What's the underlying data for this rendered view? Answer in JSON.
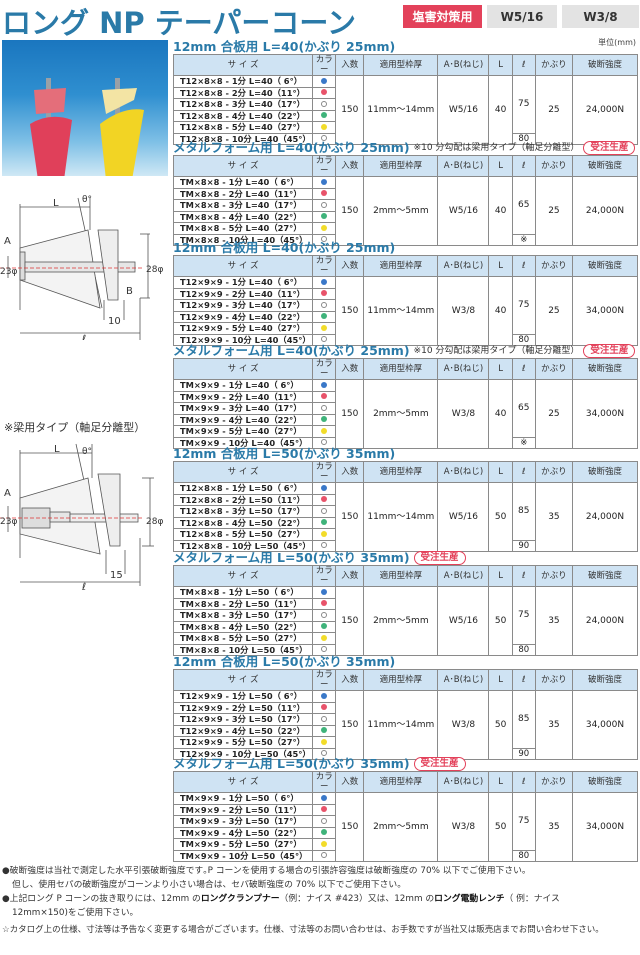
{
  "header": {
    "title": "ロング NP テーパーコーン",
    "tags": [
      "塩害対策用",
      "W5/16",
      "W3/8"
    ],
    "unit": "単位(mm)"
  },
  "photo": {
    "description": "red and yellow taper cones photo"
  },
  "diagrams": {
    "standard": {
      "labels": {
        "L": "L",
        "theta": "θ°",
        "A": "A",
        "B": "B",
        "phi23": "23φ",
        "phi28": "28φ",
        "dim10": "10",
        "ell": "ℓ"
      }
    },
    "beam_label": "※梁用タイプ（軸足分離型）",
    "beam": {
      "labels": {
        "L": "L",
        "theta": "θ°",
        "A": "A",
        "phi23": "23φ",
        "phi28": "28φ",
        "dim15": "15",
        "ell": "ℓ"
      }
    }
  },
  "columns": [
    "サ イ ズ",
    "カラー",
    "入数",
    "適用型枠厚",
    "A･B(ねじ)",
    "L",
    "ℓ",
    "かぶり",
    "破断強度"
  ],
  "colors": {
    "blue": "#3a78c8",
    "red": "#e8536a",
    "white": "#ffffff",
    "green": "#3fb37a",
    "yellow": "#f2dc2a"
  },
  "sections": [
    {
      "title": "12mm 合板用  L=40(かぶり 25mm)",
      "note": "",
      "badge": "",
      "rows": [
        {
          "size": "T12×8×8 - 1分   L=40（ 6°）",
          "color": "blue"
        },
        {
          "size": "T12×8×8 - 2分   L=40（11°）",
          "color": "red"
        },
        {
          "size": "T12×8×8 - 3分   L=40（17°）",
          "color": "white"
        },
        {
          "size": "T12×8×8 - 4分   L=40（22°）",
          "color": "green"
        },
        {
          "size": "T12×8×8 - 5分   L=40（27°）",
          "color": "yellow"
        },
        {
          "size": "T12×8×8 - 10分 L=40（45°）",
          "color": "white"
        }
      ],
      "qty": "150",
      "thickness": "11mm～14mm",
      "thread": "W5/16",
      "L": "40",
      "ell": "75",
      "ell_last": "80",
      "cover": "25",
      "strength": "24,000N"
    },
    {
      "title": "メタルフォーム用  L=40(かぶり 25mm)",
      "note": "※10 分勾配は梁用タイプ（軸足分離型）",
      "badge": "受注生産",
      "rows": [
        {
          "size": "TM×8×8 - 1分     L=40（ 6°）",
          "color": "blue"
        },
        {
          "size": "TM×8×8 - 2分     L=40（11°）",
          "color": "red"
        },
        {
          "size": "TM×8×8 - 3分     L=40（17°）",
          "color": "white"
        },
        {
          "size": "TM×8×8 - 4分     L=40（22°）",
          "color": "green"
        },
        {
          "size": "TM×8×8 - 5分     L=40（27°）",
          "color": "yellow"
        },
        {
          "size": "TM×8×8 - 10分  L=40（45°）",
          "color": "white"
        }
      ],
      "qty": "150",
      "thickness": "2mm～5mm",
      "thread": "W5/16",
      "L": "40",
      "ell": "65",
      "ell_last": "※",
      "cover": "25",
      "strength": "24,000N"
    },
    {
      "title": "12mm 合板用  L=40(かぶり 25mm)",
      "note": "",
      "badge": "",
      "rows": [
        {
          "size": "T12×9×9 - 1分   L=40（ 6°）",
          "color": "blue"
        },
        {
          "size": "T12×9×9 - 2分   L=40（11°）",
          "color": "red"
        },
        {
          "size": "T12×9×9 - 3分   L=40（17°）",
          "color": "white"
        },
        {
          "size": "T12×9×9 - 4分   L=40（22°）",
          "color": "green"
        },
        {
          "size": "T12×9×9 - 5分   L=40（27°）",
          "color": "yellow"
        },
        {
          "size": "T12×9×9 - 10分 L=40（45°）",
          "color": "white"
        }
      ],
      "qty": "150",
      "thickness": "11mm～14mm",
      "thread": "W3/8",
      "L": "40",
      "ell": "75",
      "ell_last": "80",
      "cover": "25",
      "strength": "34,000N"
    },
    {
      "title": "メタルフォーム用  L=40(かぶり 25mm)",
      "note": "※10 分勾配は梁用タイプ（軸足分離型）",
      "badge": "受注生産",
      "rows": [
        {
          "size": "TM×9×9 - 1分   L=40（ 6°）",
          "color": "blue"
        },
        {
          "size": "TM×9×9 - 2分   L=40（11°）",
          "color": "red"
        },
        {
          "size": "TM×9×9 - 3分   L=40（17°）",
          "color": "white"
        },
        {
          "size": "TM×9×9 - 4分   L=40（22°）",
          "color": "green"
        },
        {
          "size": "TM×9×9 - 5分   L=40（27°）",
          "color": "yellow"
        },
        {
          "size": "TM×9×9 - 10分 L=40（45°）",
          "color": "white"
        }
      ],
      "qty": "150",
      "thickness": "2mm～5mm",
      "thread": "W3/8",
      "L": "40",
      "ell": "65",
      "ell_last": "※",
      "cover": "25",
      "strength": "34,000N"
    },
    {
      "title": "12mm 合板用  L=50(かぶり 35mm)",
      "note": "",
      "badge": "",
      "rows": [
        {
          "size": "T12×8×8 - 1分   L=50（ 6°）",
          "color": "blue"
        },
        {
          "size": "T12×8×8 - 2分   L=50（11°）",
          "color": "red"
        },
        {
          "size": "T12×8×8 - 3分   L=50（17°）",
          "color": "white"
        },
        {
          "size": "T12×8×8 - 4分   L=50（22°）",
          "color": "green"
        },
        {
          "size": "T12×8×8 - 5分   L=50（27°）",
          "color": "yellow"
        },
        {
          "size": "T12×8×8 - 10分 L=50（45°）",
          "color": "white"
        }
      ],
      "qty": "150",
      "thickness": "11mm～14mm",
      "thread": "W5/16",
      "L": "50",
      "ell": "85",
      "ell_last": "90",
      "cover": "35",
      "strength": "24,000N"
    },
    {
      "title": "メタルフォーム用  L=50(かぶり 35mm)",
      "note": "",
      "badge": "受注生産",
      "rows": [
        {
          "size": "TM×8×8 - 1分     L=50（ 6°）",
          "color": "blue"
        },
        {
          "size": "TM×8×8 - 2分     L=50（11°）",
          "color": "red"
        },
        {
          "size": "TM×8×8 - 3分     L=50（17°）",
          "color": "white"
        },
        {
          "size": "TM×8×8 - 4分     L=50（22°）",
          "color": "green"
        },
        {
          "size": "TM×8×8 - 5分     L=50（27°）",
          "color": "yellow"
        },
        {
          "size": "TM×8×8 - 10分  L=50（45°）",
          "color": "white"
        }
      ],
      "qty": "150",
      "thickness": "2mm～5mm",
      "thread": "W5/16",
      "L": "50",
      "ell": "75",
      "ell_last": "80",
      "cover": "35",
      "strength": "24,000N"
    },
    {
      "title": "12mm 合板用  L=50(かぶり 35mm)",
      "note": "",
      "badge": "",
      "rows": [
        {
          "size": "T12×9×9 - 1分   L=50（ 6°）",
          "color": "blue"
        },
        {
          "size": "T12×9×9 - 2分   L=50（11°）",
          "color": "red"
        },
        {
          "size": "T12×9×9 - 3分   L=50（17°）",
          "color": "white"
        },
        {
          "size": "T12×9×9 - 4分   L=50（22°）",
          "color": "green"
        },
        {
          "size": "T12×9×9 - 5分   L=50（27°）",
          "color": "yellow"
        },
        {
          "size": "T12×9×9 - 10分 L=50（45°）",
          "color": "white"
        }
      ],
      "qty": "150",
      "thickness": "11mm～14mm",
      "thread": "W3/8",
      "L": "50",
      "ell": "85",
      "ell_last": "90",
      "cover": "35",
      "strength": "34,000N"
    },
    {
      "title": "メタルフォーム用  L=50(かぶり 35mm)",
      "note": "",
      "badge": "受注生産",
      "rows": [
        {
          "size": "TM×9×9 - 1分     L=50（ 6°）",
          "color": "blue"
        },
        {
          "size": "TM×9×9 - 2分     L=50（11°）",
          "color": "red"
        },
        {
          "size": "TM×9×9 - 3分     L=50（17°）",
          "color": "white"
        },
        {
          "size": "TM×9×9 - 4分     L=50（22°）",
          "color": "green"
        },
        {
          "size": "TM×9×9 - 5分     L=50（27°）",
          "color": "yellow"
        },
        {
          "size": "TM×9×9 - 10分  L=50（45°）",
          "color": "white"
        }
      ],
      "qty": "150",
      "thickness": "2mm～5mm",
      "thread": "W3/8",
      "L": "50",
      "ell": "75",
      "ell_last": "80",
      "cover": "35",
      "strength": "34,000N"
    }
  ],
  "footer": {
    "note1a": "●破断強度は当社で測定した水平引張破断強度です｡P コーンを使用する場合の引張許容強度は破断強度の 70% 以下でご使用下さい。",
    "note1b": "但し、使用セパの破断強度がコーンより小さい場合は、セパ破断強度の 70% 以下でご使用下さい。",
    "note2_pre": "●上記ロング P コーンの抜き取りには、12mm の",
    "note2_bold1": "ロングクランプナー",
    "note2_mid": "（例：ナイス #423）又は、12mm の",
    "note2_bold2": "ロング電動レンチ",
    "note2_post": "（ 例：ナイス",
    "note2b": "12mm×150)をご使用下さい。",
    "note3": "☆カタログ上の仕様、寸法等は予告なく変更する場合がございます。仕様、寸法等のお問い合わせは、お手数ですが当社又は販売店までお問い合わせ下さい。"
  }
}
